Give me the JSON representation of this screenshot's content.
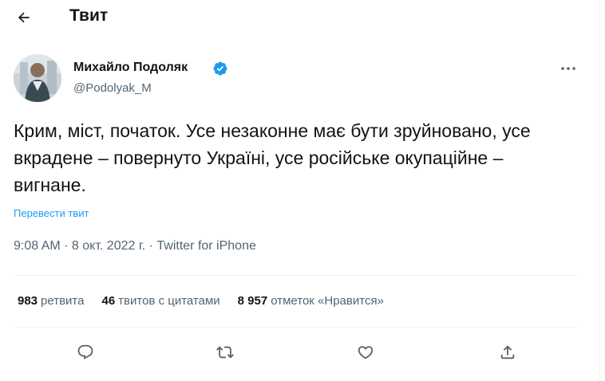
{
  "header": {
    "title": "Твит"
  },
  "author": {
    "name": "Михайло Подоляк",
    "handle": "@Podolyak_M"
  },
  "tweet": {
    "text": "Крим, міст, початок. Усе незаконне має бути зруйновано, усе вкрадене – повернуто Україні, усе російське окупаційне – вигнане.",
    "translate_link": "Перевести твит",
    "time": "9:08 AM",
    "separator": " · ",
    "date": "8 окт. 2022 г.",
    "source": "Twitter for iPhone"
  },
  "stats": {
    "retweets": {
      "value": "983",
      "label": "ретвита"
    },
    "quotes": {
      "value": "46",
      "label": "твитов с цитатами"
    },
    "likes": {
      "value": "8 957",
      "label": "отметок «Нравится»"
    }
  },
  "icons": {
    "back": "arrow-left-icon",
    "verified": "verified-badge-icon",
    "more": "more-horizontal-icon",
    "reply": "reply-icon",
    "retweet": "retweet-icon",
    "like": "heart-icon",
    "share": "share-icon"
  },
  "colors": {
    "accent": "#1d9bf0",
    "text": "#0f1419",
    "secondary": "#536471"
  }
}
